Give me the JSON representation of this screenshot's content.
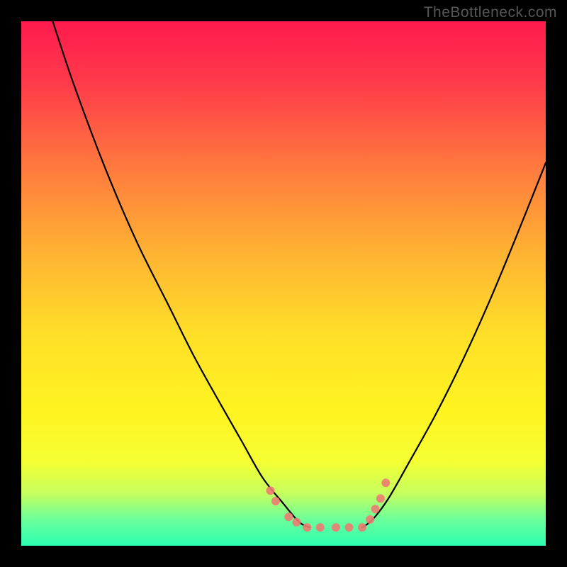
{
  "watermark": "TheBottleneck.com",
  "chart_data": {
    "type": "line",
    "title": "",
    "xlabel": "",
    "ylabel": "",
    "xlim": [
      0,
      100
    ],
    "ylim": [
      0,
      100
    ],
    "background_gradient": {
      "stops": [
        {
          "offset": 0.0,
          "color": "#ff1a4d"
        },
        {
          "offset": 0.12,
          "color": "#ff3b4a"
        },
        {
          "offset": 0.28,
          "color": "#ff7a3e"
        },
        {
          "offset": 0.44,
          "color": "#ffb233"
        },
        {
          "offset": 0.6,
          "color": "#ffe028"
        },
        {
          "offset": 0.74,
          "color": "#fff320"
        },
        {
          "offset": 0.84,
          "color": "#f5ff33"
        },
        {
          "offset": 0.9,
          "color": "#c6ff5e"
        },
        {
          "offset": 0.95,
          "color": "#6bff9b"
        },
        {
          "offset": 1.0,
          "color": "#2bffb0"
        }
      ]
    },
    "series": [
      {
        "name": "left-curve",
        "color": "#000000",
        "values": [
          {
            "x": 6.0,
            "y": 100.0
          },
          {
            "x": 10.0,
            "y": 88.0
          },
          {
            "x": 16.0,
            "y": 72.0
          },
          {
            "x": 22.0,
            "y": 58.0
          },
          {
            "x": 28.0,
            "y": 46.0
          },
          {
            "x": 33.0,
            "y": 36.0
          },
          {
            "x": 38.0,
            "y": 27.0
          },
          {
            "x": 42.0,
            "y": 20.0
          },
          {
            "x": 46.0,
            "y": 13.0
          },
          {
            "x": 50.0,
            "y": 8.0
          },
          {
            "x": 53.0,
            "y": 4.5
          },
          {
            "x": 55.0,
            "y": 3.5
          }
        ]
      },
      {
        "name": "right-curve",
        "color": "#000000",
        "values": [
          {
            "x": 65.0,
            "y": 3.5
          },
          {
            "x": 67.0,
            "y": 5.0
          },
          {
            "x": 70.0,
            "y": 9.0
          },
          {
            "x": 74.0,
            "y": 16.0
          },
          {
            "x": 79.0,
            "y": 25.0
          },
          {
            "x": 84.0,
            "y": 35.0
          },
          {
            "x": 89.0,
            "y": 46.0
          },
          {
            "x": 94.0,
            "y": 58.0
          },
          {
            "x": 100.0,
            "y": 73.0
          }
        ]
      },
      {
        "name": "bottom-markers",
        "color": "#ed7c72",
        "type": "scatter",
        "marker_radius": 6,
        "values": [
          {
            "x": 47.5,
            "y": 10.5
          },
          {
            "x": 48.5,
            "y": 8.5
          },
          {
            "x": 51.0,
            "y": 5.5
          },
          {
            "x": 52.5,
            "y": 4.5
          },
          {
            "x": 54.5,
            "y": 3.5
          },
          {
            "x": 57.0,
            "y": 3.5
          },
          {
            "x": 60.0,
            "y": 3.5
          },
          {
            "x": 62.5,
            "y": 3.5
          },
          {
            "x": 65.0,
            "y": 3.5
          },
          {
            "x": 66.5,
            "y": 5.0
          },
          {
            "x": 67.5,
            "y": 7.0
          },
          {
            "x": 68.5,
            "y": 9.0
          },
          {
            "x": 69.5,
            "y": 12.0
          }
        ]
      }
    ]
  }
}
